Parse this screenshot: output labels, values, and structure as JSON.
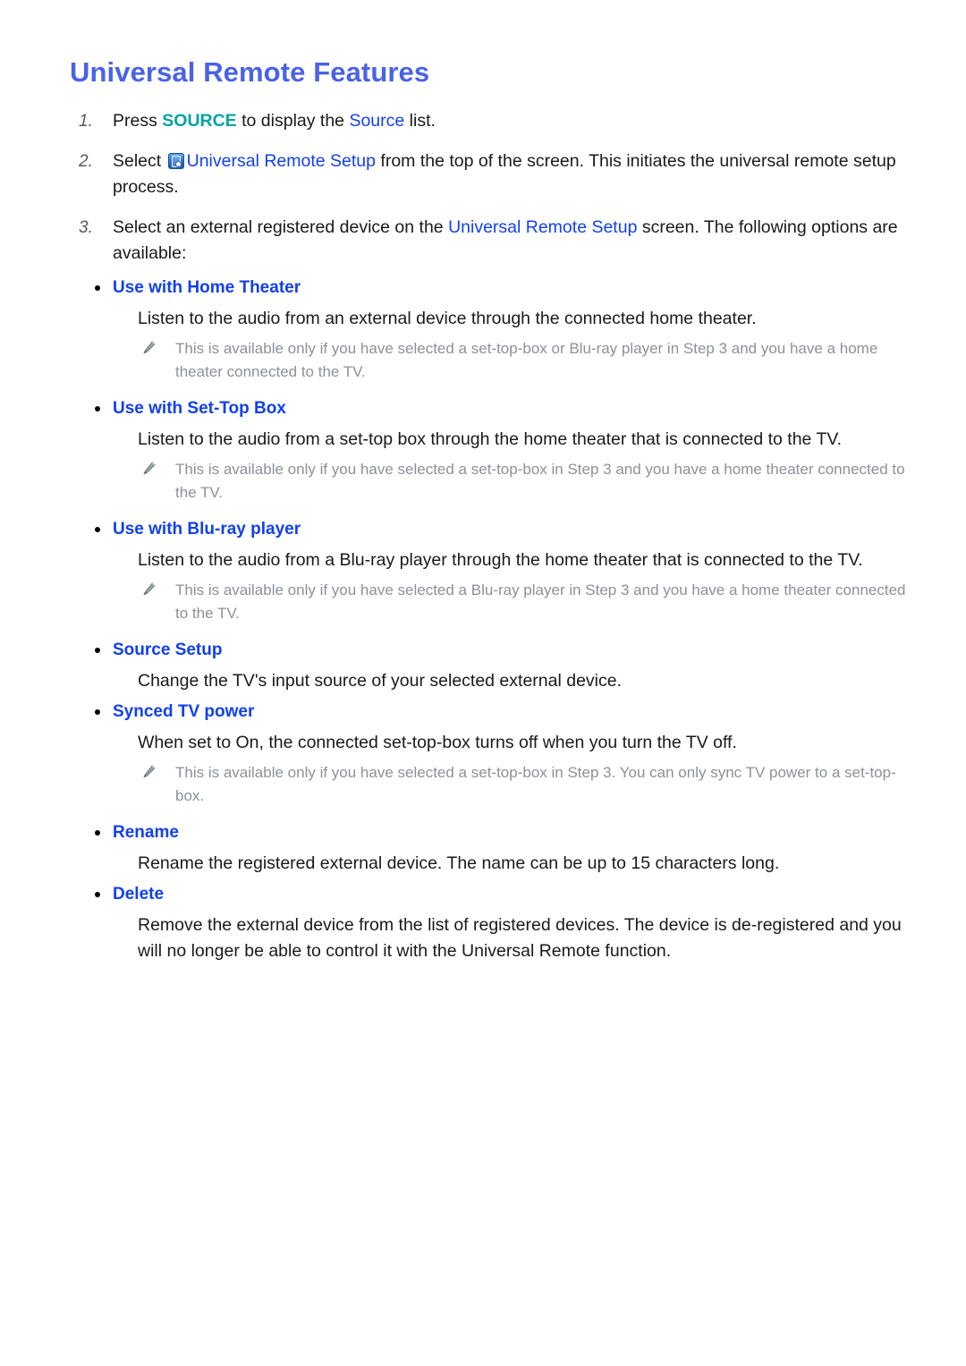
{
  "document": {
    "title": "Universal Remote Features",
    "colors": {
      "title_blue": "#4a62e8",
      "link_blue": "#1240ee",
      "key_teal": "#00a3a3",
      "note_gray": "#8b9296",
      "body_black": "#1a1a1a"
    }
  },
  "steps": [
    {
      "number": "1.",
      "parts": [
        {
          "text": "Press ",
          "style": "plain"
        },
        {
          "text": "SOURCE",
          "style": "teal"
        },
        {
          "text": " to display the ",
          "style": "plain"
        },
        {
          "text": "Source",
          "style": "blue"
        },
        {
          "text": " list.",
          "style": "plain"
        }
      ]
    },
    {
      "number": "2.",
      "parts": [
        {
          "text": "Select ",
          "style": "plain"
        },
        {
          "text": "",
          "style": "icon",
          "icon": "universal-remote-setup-icon"
        },
        {
          "text": "Universal Remote Setup",
          "style": "blue"
        },
        {
          "text": " from the top of the screen. This initiates the universal remote setup process.",
          "style": "plain"
        }
      ]
    },
    {
      "number": "3.",
      "parts": [
        {
          "text": "Select an external registered device on the ",
          "style": "plain"
        },
        {
          "text": "Universal Remote Setup",
          "style": "blue"
        },
        {
          "text": " screen. The following options are available:",
          "style": "plain"
        }
      ]
    }
  ],
  "options": [
    {
      "heading": "Use with Home Theater",
      "description": "Listen to the audio from an external device through the connected home theater.",
      "note": "This is available only if you have selected a set-top-box or Blu-ray player in Step 3 and you have a home theater connected to the TV."
    },
    {
      "heading": "Use with Set-Top Box",
      "description": "Listen to the audio from a set-top box through the home theater that is connected to the TV.",
      "note": "This is available only if you have selected a set-top-box in Step 3 and you have a home theater connected to the TV."
    },
    {
      "heading": "Use with Blu-ray player",
      "description": "Listen to the audio from a Blu-ray player through the home theater that is connected to the TV.",
      "note": "This is available only if you have selected a Blu-ray player in Step 3 and you have a home theater connected to the TV."
    },
    {
      "heading": "Source Setup",
      "description": "Change the TV's input source of your selected external device.",
      "note": ""
    },
    {
      "heading": "Synced TV power",
      "description": "When set to On, the connected set-top-box turns off when you turn the TV off.",
      "note": "This is available only if you have selected a set-top-box in Step 3. You can only sync TV power to a set-top-box."
    },
    {
      "heading": "Rename",
      "description": "Rename the registered external device. The name can be up to 15 characters long.",
      "note": ""
    },
    {
      "heading": "Delete",
      "description": "Remove the external device from the list of registered devices. The device is de-registered and you will no longer be able to control it with the Universal Remote function.",
      "note": ""
    }
  ]
}
